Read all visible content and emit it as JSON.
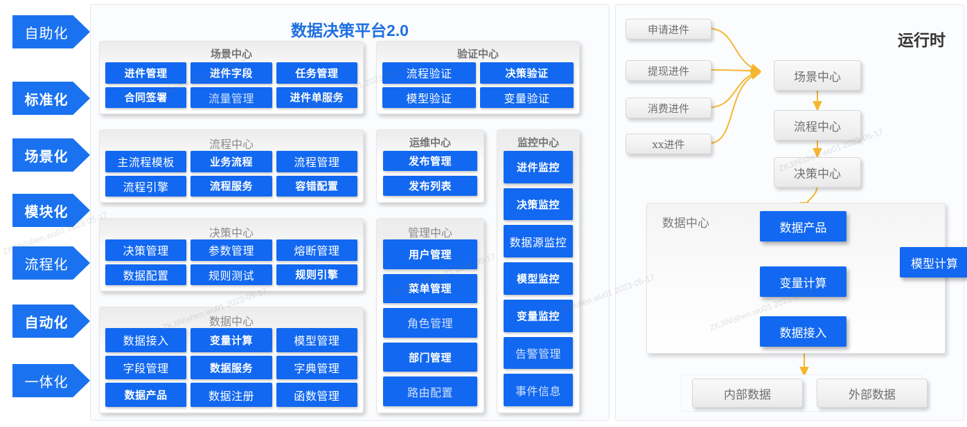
{
  "colors": {
    "primary_blue": "#1268f0",
    "arrow_blue": "#1a72f0",
    "title_blue": "#1f6fe0",
    "flow_arrow": "#f5b731",
    "panel_bg": "#fafcfe"
  },
  "rail": {
    "arrows": [
      {
        "label": "自助化",
        "bold": false
      },
      {
        "label": "标准化",
        "bold": true
      },
      {
        "label": "场景化",
        "bold": true
      },
      {
        "label": "模块化",
        "bold": true
      },
      {
        "label": "流程化",
        "bold": false
      },
      {
        "label": "自动化",
        "bold": true
      },
      {
        "label": "一体化",
        "bold": false
      }
    ]
  },
  "platform": {
    "title_text": "数据决策平台",
    "title_version": "2.0"
  },
  "groups": {
    "scene_center": {
      "title": "场景中心",
      "rows": [
        [
          {
            "label": "进件管理",
            "bold": true
          },
          {
            "label": "进件字段",
            "bold": true
          },
          {
            "label": "任务管理",
            "bold": true
          }
        ],
        [
          {
            "label": "合同签署",
            "bold": true
          },
          {
            "label": "流量管理",
            "bold": false,
            "faded": true
          },
          {
            "label": "进件单服务",
            "bold": true
          }
        ]
      ]
    },
    "verify_center": {
      "title": "验证中心",
      "rows": [
        [
          {
            "label": "流程验证",
            "bold": false
          },
          {
            "label": "决策验证",
            "bold": true
          }
        ],
        [
          {
            "label": "模型验证",
            "bold": false
          },
          {
            "label": "变量验证",
            "bold": false
          }
        ]
      ]
    },
    "process_center": {
      "title": "流程中心",
      "rows": [
        [
          {
            "label": "主流程模板",
            "bold": false
          },
          {
            "label": "业务流程",
            "bold": true
          },
          {
            "label": "流程管理",
            "bold": false
          }
        ],
        [
          {
            "label": "流程引擎",
            "bold": false
          },
          {
            "label": "流程服务",
            "bold": true
          },
          {
            "label": "容错配置",
            "bold": true
          }
        ]
      ]
    },
    "ops_center": {
      "title": "运维中心",
      "items": [
        {
          "label": "发布管理",
          "bold": true
        },
        {
          "label": "发布列表",
          "bold": true
        }
      ]
    },
    "monitor_center": {
      "title": "监控中心",
      "items": [
        {
          "label": "进件监控",
          "bold": true
        },
        {
          "label": "决策监控",
          "bold": true
        },
        {
          "label": "数据源监控",
          "bold": false
        },
        {
          "label": "模型监控",
          "bold": true
        },
        {
          "label": "变量监控",
          "bold": true
        },
        {
          "label": "告警管理",
          "bold": false,
          "faded": true
        },
        {
          "label": "事件信息",
          "bold": false,
          "faded": true
        }
      ]
    },
    "decision_center": {
      "title": "决策中心",
      "rows": [
        [
          {
            "label": "决策管理",
            "bold": false
          },
          {
            "label": "参数管理",
            "bold": false
          },
          {
            "label": "熔断管理",
            "bold": false
          }
        ],
        [
          {
            "label": "数据配置",
            "bold": false
          },
          {
            "label": "规则测试",
            "bold": false
          },
          {
            "label": "规则引擎",
            "bold": true
          }
        ]
      ]
    },
    "admin_center": {
      "title": "管理中心",
      "items": [
        {
          "label": "用户管理",
          "bold": true
        },
        {
          "label": "菜单管理",
          "bold": true
        },
        {
          "label": "角色管理",
          "bold": false,
          "faded": true
        },
        {
          "label": "部门管理",
          "bold": true
        },
        {
          "label": "路由配置",
          "bold": false,
          "faded": true
        }
      ]
    },
    "data_center": {
      "title": "数据中心",
      "rows": [
        [
          {
            "label": "数据接入",
            "bold": false
          },
          {
            "label": "变量计算",
            "bold": true
          },
          {
            "label": "模型管理",
            "bold": false
          }
        ],
        [
          {
            "label": "字段管理",
            "bold": false
          },
          {
            "label": "数据服务",
            "bold": true
          },
          {
            "label": "字典管理",
            "bold": false
          }
        ],
        [
          {
            "label": "数据产品",
            "bold": true
          },
          {
            "label": "数据注册",
            "bold": false
          },
          {
            "label": "函数管理",
            "bold": false
          }
        ]
      ]
    }
  },
  "runtime": {
    "title": "运行时",
    "inputs": [
      {
        "label": "申请进件"
      },
      {
        "label": "提现进件"
      },
      {
        "label": "消费进件"
      },
      {
        "label": "xx进件"
      }
    ],
    "pipeline": [
      {
        "label": "场景中心"
      },
      {
        "label": "流程中心"
      },
      {
        "label": "决策中心"
      }
    ],
    "data_center": {
      "label": "数据中心",
      "nodes": [
        {
          "label": "数据产品"
        },
        {
          "label": "模型计算"
        },
        {
          "label": "变量计算"
        },
        {
          "label": "数据接入"
        }
      ]
    },
    "sources": [
      {
        "label": "内部数据"
      },
      {
        "label": "外部数据"
      }
    ]
  },
  "watermarks": [
    "ZKJIN\\shen.wu01 2023-05-17",
    "ZKJIN\\shen.wu01 2023-05-17",
    "ZKJIN\\shen.wu01 2023-05-17",
    "ZKJIN\\shen.wu01 2023-05-17",
    "ZKJIN\\shen.wu01 2023-05-17",
    "ZKJIN\\shen.wu01 2023-05-17"
  ]
}
